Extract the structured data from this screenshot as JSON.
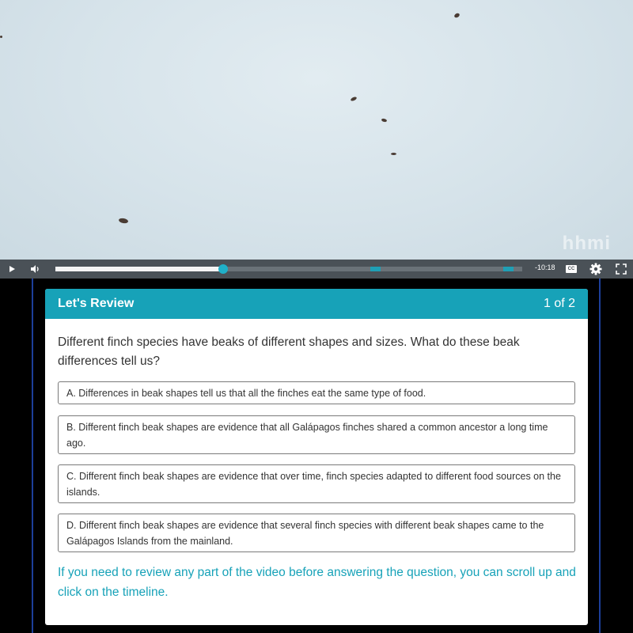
{
  "video": {
    "watermark": "hhmi",
    "progress_percent": 36,
    "time_remaining": "-10:18",
    "cc_label": "CC"
  },
  "controls": {
    "play_icon": "play-icon",
    "volume_icon": "volume-icon",
    "settings_icon": "gear-icon",
    "fullscreen_icon": "fullscreen-icon"
  },
  "review": {
    "title": "Let's Review",
    "counter": "1 of 2",
    "question": "Different finch species have beaks of different shapes and sizes. What do these beak differences tell us?",
    "options": [
      "A. Differences in beak shapes tell us that all the finches eat the same type of food.",
      "B. Different finch beak shapes are evidence that all Galápagos finches shared a common ancestor a long time ago.",
      "C. Different finch beak shapes are evidence that over time, finch species adapted to different food sources on the islands.",
      "D. Different finch beak shapes are evidence that several finch species with different beak shapes came to the Galápagos Islands from the mainland."
    ],
    "hint": "If you need to review any part of the video before answering the question, you can scroll up and click on the timeline."
  },
  "colors": {
    "accent": "#17a2b8",
    "control_bar": "#4a5157",
    "frame_border": "#1d3f9a"
  }
}
